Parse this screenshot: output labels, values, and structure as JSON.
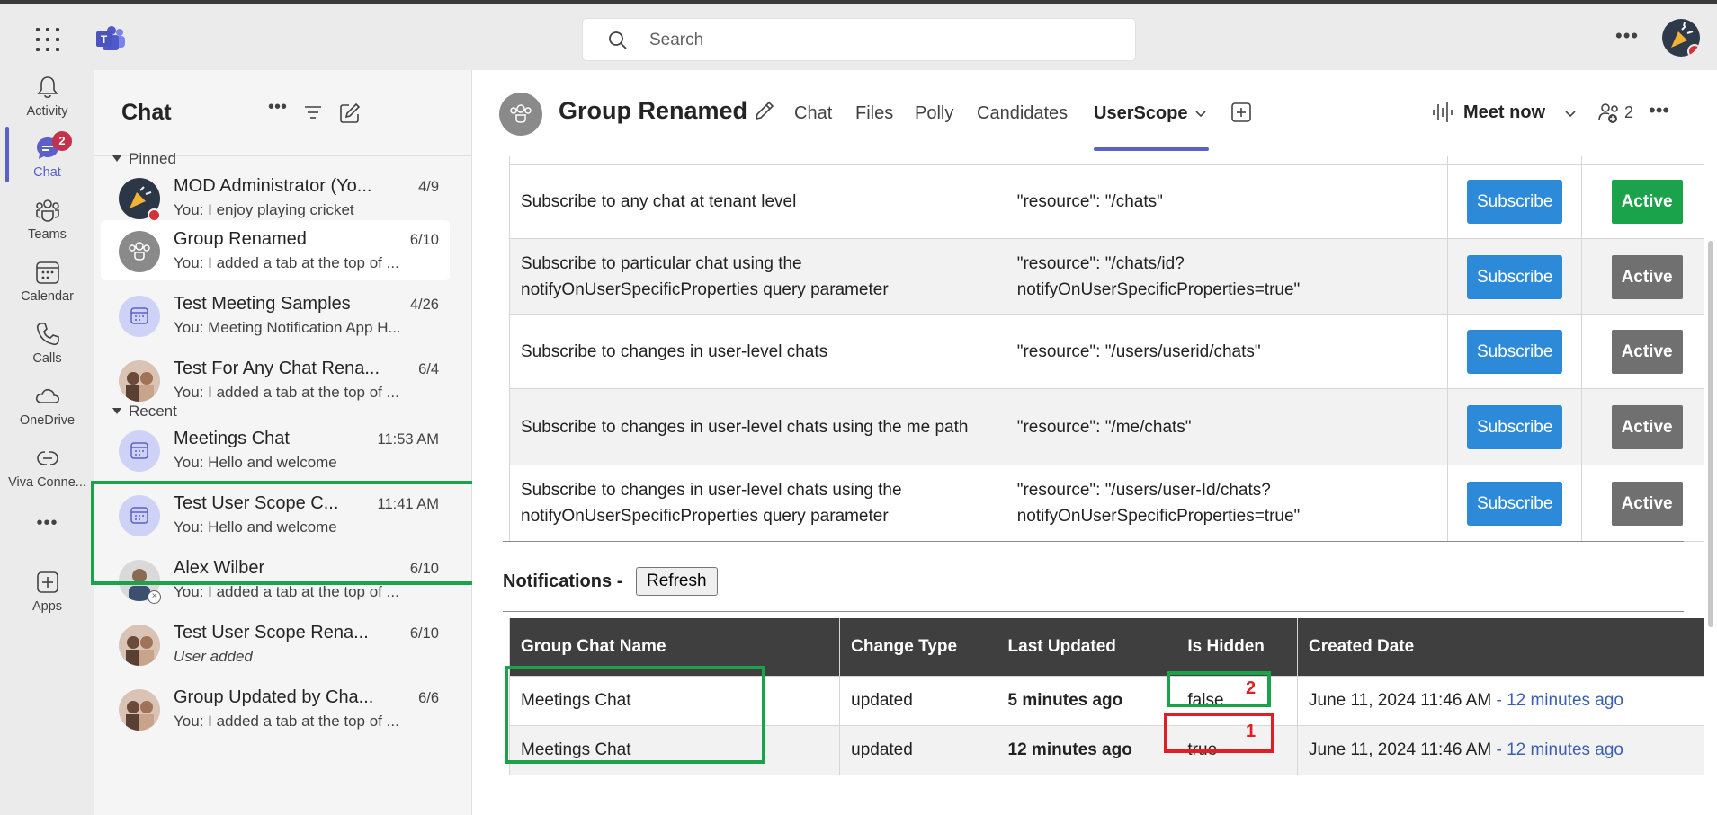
{
  "search": {
    "placeholder": "Search"
  },
  "rail": {
    "items": [
      {
        "label": "Activity"
      },
      {
        "label": "Chat",
        "badge": "2"
      },
      {
        "label": "Teams"
      },
      {
        "label": "Calendar"
      },
      {
        "label": "Calls"
      },
      {
        "label": "OneDrive"
      },
      {
        "label": "Viva Conne..."
      },
      {
        "label": "Apps"
      }
    ],
    "more": "•••"
  },
  "chatpane": {
    "title": "Chat",
    "pinned_label": "Pinned",
    "recent_label": "Recent",
    "pinned": [
      {
        "name": "MOD Administrator (Yo...",
        "time": "4/9",
        "preview": "You: I enjoy playing cricket"
      },
      {
        "name": "Group Renamed",
        "time": "6/10",
        "preview": "You: I added a tab at the top of ..."
      },
      {
        "name": "Test Meeting Samples",
        "time": "4/26",
        "preview": "You: Meeting Notification App H..."
      },
      {
        "name": "Test For Any Chat Rena...",
        "time": "6/4",
        "preview": "You: I added a tab at the top of ..."
      }
    ],
    "recent": [
      {
        "name": "Meetings Chat",
        "time": "11:53 AM",
        "preview": "You: Hello and welcome"
      },
      {
        "name": "Test User Scope C...",
        "time": "11:41 AM",
        "preview": "You: Hello and welcome"
      },
      {
        "name": "Alex Wilber",
        "time": "6/10",
        "preview": "You: I added a tab at the top of ..."
      },
      {
        "name": "Test User Scope Rena...",
        "time": "6/10",
        "preview": "User added"
      },
      {
        "name": "Group Updated by Cha...",
        "time": "6/6",
        "preview": "You: I added a tab at the top of ..."
      }
    ]
  },
  "header": {
    "title": "Group Renamed",
    "tabs": [
      "Chat",
      "Files",
      "Polly",
      "Candidates",
      "UserScope"
    ],
    "active_tab": "UserScope",
    "meet_now": "Meet now",
    "participants": "2",
    "more": "•••"
  },
  "subscriptions": {
    "rows": [
      {
        "desc": "Subscribe to any chat at tenant level",
        "resource": "\"resource\": \"/chats\"",
        "button": "Subscribe",
        "status": "Active",
        "status_active": true
      },
      {
        "desc": "Subscribe to particular chat using the notifyOnUserSpecificProperties query parameter",
        "resource": "\"resource\": \"/chats/id? notifyOnUserSpecificProperties=true\"",
        "button": "Subscribe",
        "status": "Active",
        "status_active": false
      },
      {
        "desc": "Subscribe to changes in user-level chats",
        "resource": "\"resource\": \"/users/userid/chats\"",
        "button": "Subscribe",
        "status": "Active",
        "status_active": false
      },
      {
        "desc": "Subscribe to changes in user-level chats using the me path",
        "resource": "\"resource\": \"/me/chats\"",
        "button": "Subscribe",
        "status": "Active",
        "status_active": false
      },
      {
        "desc": "Subscribe to changes in user-level chats using the notifyOnUserSpecificProperties query parameter",
        "resource": "\"resource\": \"/users/user-Id/chats? notifyOnUserSpecificProperties=true\"",
        "button": "Subscribe",
        "status": "Active",
        "status_active": false
      }
    ]
  },
  "notifications": {
    "label": "Notifications",
    "dash": "-",
    "refresh": "Refresh",
    "columns": [
      "Group Chat Name",
      "Change Type",
      "Last Updated",
      "Is Hidden",
      "Created Date"
    ],
    "rows": [
      {
        "name": "Meetings Chat",
        "change": "updated",
        "last_updated": "5 minutes ago",
        "hidden": "false",
        "created": "June 11, 2024 11:46 AM",
        "created_rel": " - 12 minutes ago",
        "marker": "2"
      },
      {
        "name": "Meetings Chat",
        "change": "updated",
        "last_updated": "12 minutes ago",
        "hidden": "true",
        "created": "June 11, 2024 11:46 AM",
        "created_rel": " - 12 minutes ago",
        "marker": "1"
      }
    ]
  },
  "colors": {
    "accent": "#5b5fc7",
    "subscribe": "#2d8ad8",
    "active_green": "#1aa34a",
    "active_gray": "#707070",
    "highlight_green": "#1aa34a",
    "highlight_red": "#e01e26"
  }
}
